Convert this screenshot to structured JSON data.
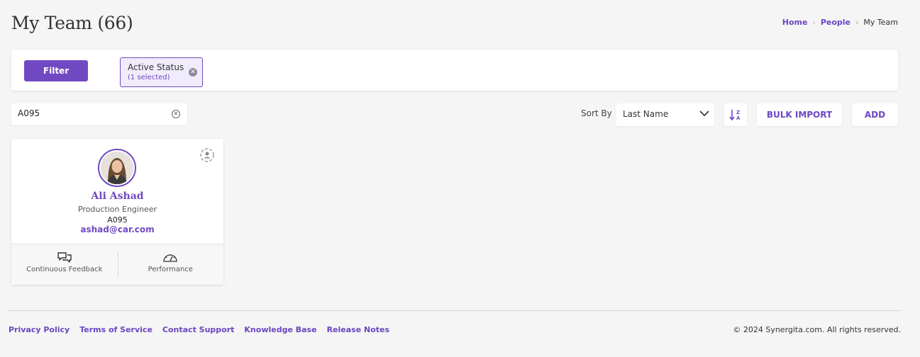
{
  "page": {
    "title": "My Team (66)"
  },
  "breadcrumb": {
    "home": "Home",
    "people": "People",
    "current": "My Team"
  },
  "filters": {
    "button_label": "Filter",
    "chips": [
      {
        "label": "Active Status",
        "count": "(1 selected)"
      }
    ]
  },
  "search": {
    "value": "A095",
    "placeholder": ""
  },
  "sort": {
    "label": "Sort By",
    "selected": "Last Name",
    "direction_icon": "sort-alpha-icon"
  },
  "actions": {
    "bulk_import": "BULK IMPORT",
    "add": "ADD"
  },
  "cards": [
    {
      "name": "Ali Ashad",
      "role": "Production Engineer",
      "employee_id": "A095",
      "email": "ashad@car.com",
      "actions": [
        {
          "label": "Continuous Feedback",
          "icon": "chat-bubbles-icon"
        },
        {
          "label": "Performance",
          "icon": "gauge-icon"
        }
      ]
    }
  ],
  "footer": {
    "links": [
      "Privacy Policy",
      "Terms of Service",
      "Contact Support",
      "Knowledge Base",
      "Release Notes"
    ],
    "copyright": "© 2024 Synergita.com. All rights reserved."
  },
  "colors": {
    "accent": "#7049c2",
    "background": "#f5f5f5"
  }
}
